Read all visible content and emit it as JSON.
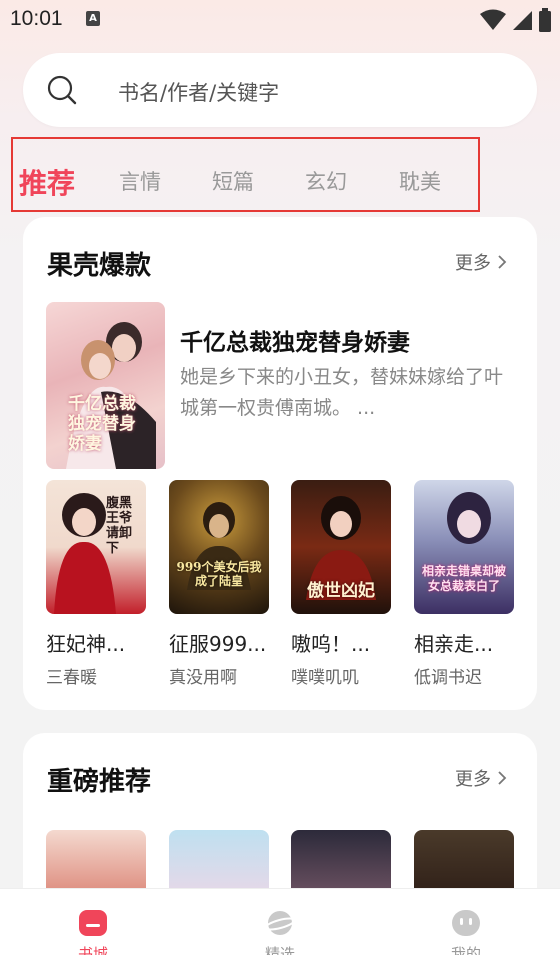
{
  "status_bar": {
    "time": "10:01",
    "notif_icon": "A"
  },
  "search": {
    "placeholder": "书名/作者/关键字"
  },
  "tabs": [
    {
      "label": "推荐",
      "active": true
    },
    {
      "label": "言情"
    },
    {
      "label": "短篇"
    },
    {
      "label": "玄幻"
    },
    {
      "label": "耽美"
    }
  ],
  "section1": {
    "title": "果壳爆款",
    "more_label": "更多",
    "featured": {
      "title": "千亿总裁独宠替身娇妻",
      "description": "她是乡下来的小丑女，替妹妹嫁给了叶城第一权贵傅南城。 ...",
      "cover_text": "千亿总裁独宠替身娇妻"
    },
    "books": [
      {
        "title": "狂妃神...",
        "author": "三春暖",
        "cover_text": "腹黑王爷请卸下"
      },
      {
        "title": "征服999...",
        "author": "真没用啊",
        "cover_text": "999个美女后我成了陆皇"
      },
      {
        "title": "嗷呜！...",
        "author": "噗噗叽叽",
        "cover_text": "傲世凶妃"
      },
      {
        "title": "相亲走...",
        "author": "低调书迟",
        "cover_text": "相亲走错桌却被女总裁表白了"
      }
    ]
  },
  "section2": {
    "title": "重磅推荐",
    "more_label": "更多"
  },
  "bottom_nav": [
    {
      "label": "书城",
      "icon": "bookstore-icon",
      "active": true
    },
    {
      "label": "精选",
      "icon": "planet-icon"
    },
    {
      "label": "我的",
      "icon": "profile-face-icon"
    }
  ],
  "colors": {
    "accent": "#f0455a",
    "tab_inactive": "#999999",
    "highlight_frame": "#e53935"
  }
}
